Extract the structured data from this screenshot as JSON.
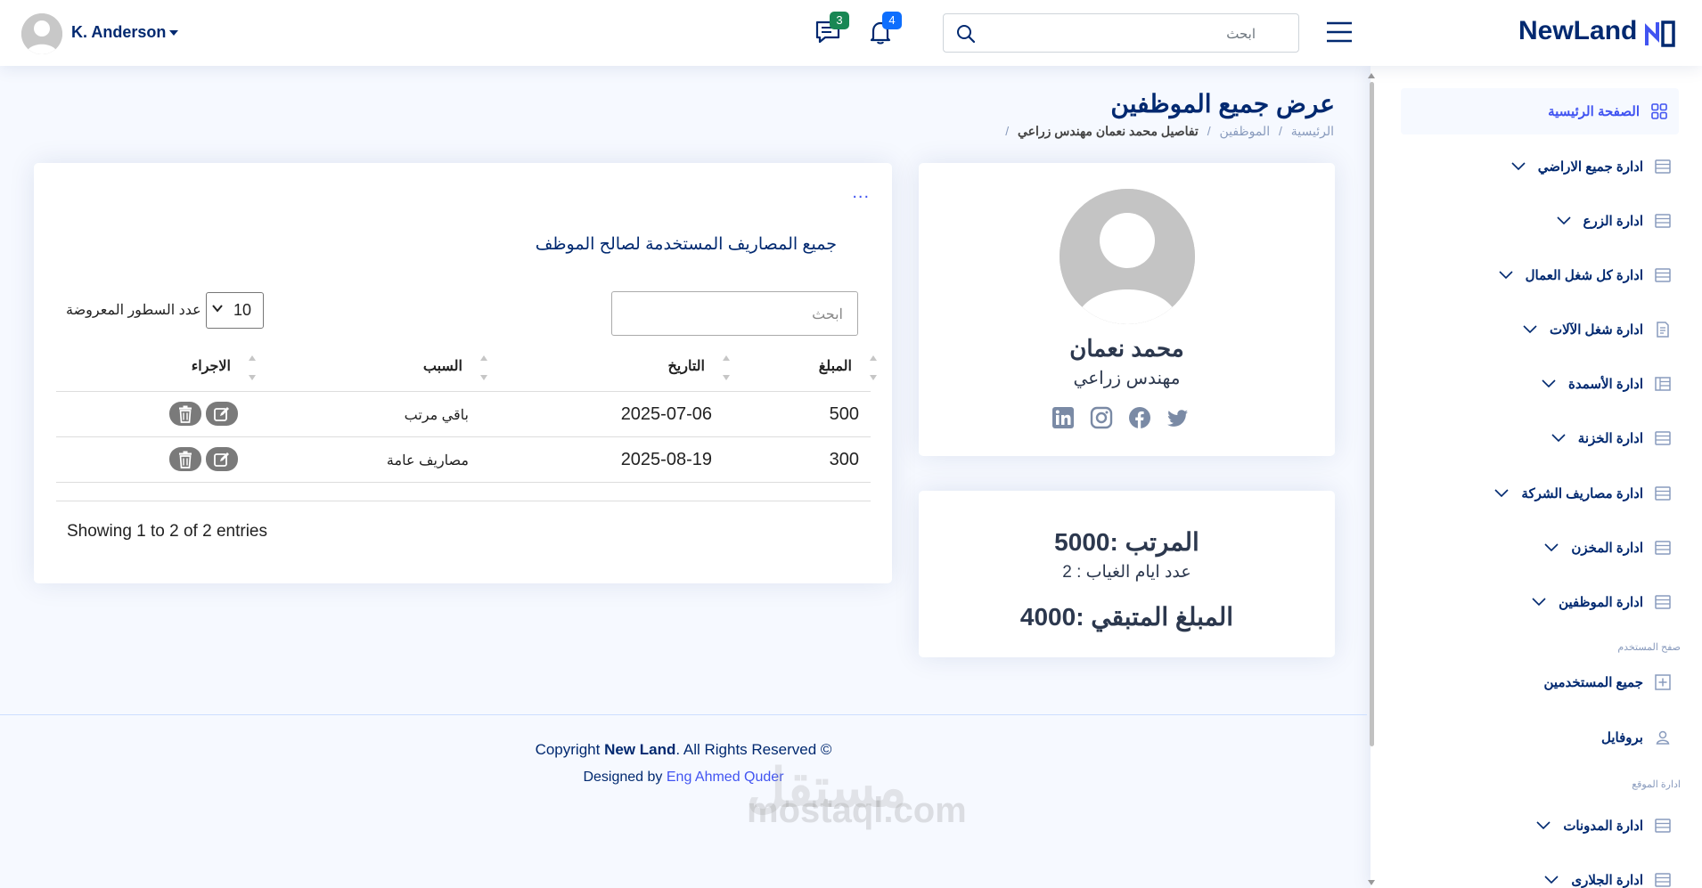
{
  "header": {
    "user_name": "K. Anderson",
    "messages_count": "3",
    "notifications_count": "4",
    "search_placeholder": "ابحث",
    "logo_text": "NewLand",
    "colors": {
      "brand": "#012970",
      "accent": "#4154f1",
      "messages_badge": "#198754",
      "notifications_badge": "#0d6efd"
    }
  },
  "sidebar": {
    "items": [
      {
        "label": "الصفحة الرئيسية",
        "icon": "grid-icon",
        "active": true
      },
      {
        "label": "ادارة جميع الاراضي",
        "icon": "layout-list-icon"
      },
      {
        "label": "ادارة الزرع",
        "icon": "layout-list-icon"
      },
      {
        "label": "ادارة كل شغل العمال",
        "icon": "layout-list-icon"
      },
      {
        "label": "ادارة شغل الآلات",
        "icon": "document-icon"
      },
      {
        "label": "ادارة الأسمدة",
        "icon": "table-icon"
      },
      {
        "label": "ادارة الخزنة",
        "icon": "layout-list-icon"
      },
      {
        "label": "ادارة مصاريف الشركة",
        "icon": "layout-list-icon"
      },
      {
        "label": "ادارة المخزن",
        "icon": "layout-list-icon"
      },
      {
        "label": "ادارة الموظفين",
        "icon": "layout-list-icon"
      }
    ],
    "section_user": "صفح المستخدم",
    "user_items": [
      {
        "label": "جميع المستخدمين",
        "icon": "plus-square-icon"
      },
      {
        "label": "بروفايل",
        "icon": "person-icon"
      }
    ],
    "section_site": "ادارة الموقع",
    "site_items": [
      {
        "label": "ادارة المدونات",
        "icon": "layout-list-icon"
      },
      {
        "label": "ادارة الجلارى",
        "icon": "layout-list-icon"
      }
    ]
  },
  "page": {
    "title": "عرض جميع الموظفين",
    "breadcrumb": [
      "الرئيسية",
      "الموظفين",
      "تفاصيل محمد نعمان مهندس زراعي"
    ],
    "breadcrumb_separator": "/"
  },
  "profile": {
    "name": "محمد نعمان",
    "job": "مهندس زراعي",
    "socials": [
      "twitter-icon",
      "facebook-icon",
      "instagram-icon",
      "linkedin-icon"
    ]
  },
  "salary": {
    "salary_line": "المرتب :5000",
    "absence_line": "عدد ايام الغياب : 2",
    "remaining_line": "المبلغ المتبقي :4000"
  },
  "expenses": {
    "menu_dots": "...",
    "title": "جميع المصاريف المستخدمة لصالح الموظف",
    "search_placeholder": "ابحث",
    "page_length": "10",
    "page_length_label": "عدد السطور المعروضة",
    "columns": [
      "المبلغ",
      "التاريخ",
      "السبب",
      "الاجراء"
    ],
    "rows": [
      {
        "amount": "500",
        "date": "2025-07-06",
        "reason": "باقي مرتب"
      },
      {
        "amount": "300",
        "date": "2025-08-19",
        "reason": "مصاريف عامة"
      }
    ],
    "info": "Showing 1 to 2 of 2 entries"
  },
  "footer": {
    "copyright_prefix": "Copyright",
    "copyright_brand": "New Land",
    "copyright_suffix": ". All Rights Reserved ©",
    "designed_prefix": "Designed by",
    "designed_link": "Eng Ahmed Quder"
  },
  "watermark": {
    "ar": "مستقل",
    "en": "mostaql.com"
  }
}
